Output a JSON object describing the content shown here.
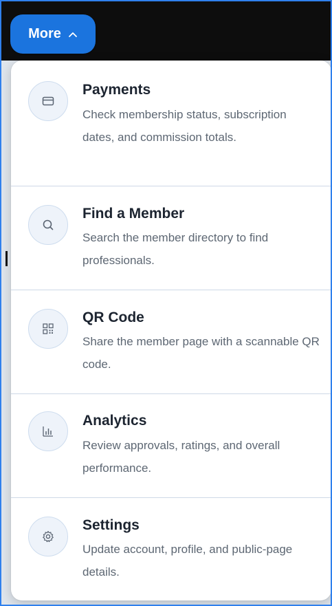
{
  "more_button": {
    "label": "More",
    "icon": "chevron-up-icon"
  },
  "menu": {
    "items": [
      {
        "title": "Payments",
        "description": "Check membership status, subscription dates, and commission totals.",
        "icon": "credit-card-icon"
      },
      {
        "title": "Find a Member",
        "description": "Search the member directory to find professionals.",
        "icon": "search-icon"
      },
      {
        "title": "QR Code",
        "description": "Share the member page with a scannable QR code.",
        "icon": "qr-code-icon"
      },
      {
        "title": "Analytics",
        "description": "Review approvals, ratings, and overall performance.",
        "icon": "bar-chart-icon"
      },
      {
        "title": "Settings",
        "description": "Update account, profile, and public-page details.",
        "icon": "gear-icon"
      }
    ]
  },
  "colors": {
    "accent": "#1b74de",
    "topbar": "#0d0d0d",
    "frame": "#2f80ed"
  }
}
